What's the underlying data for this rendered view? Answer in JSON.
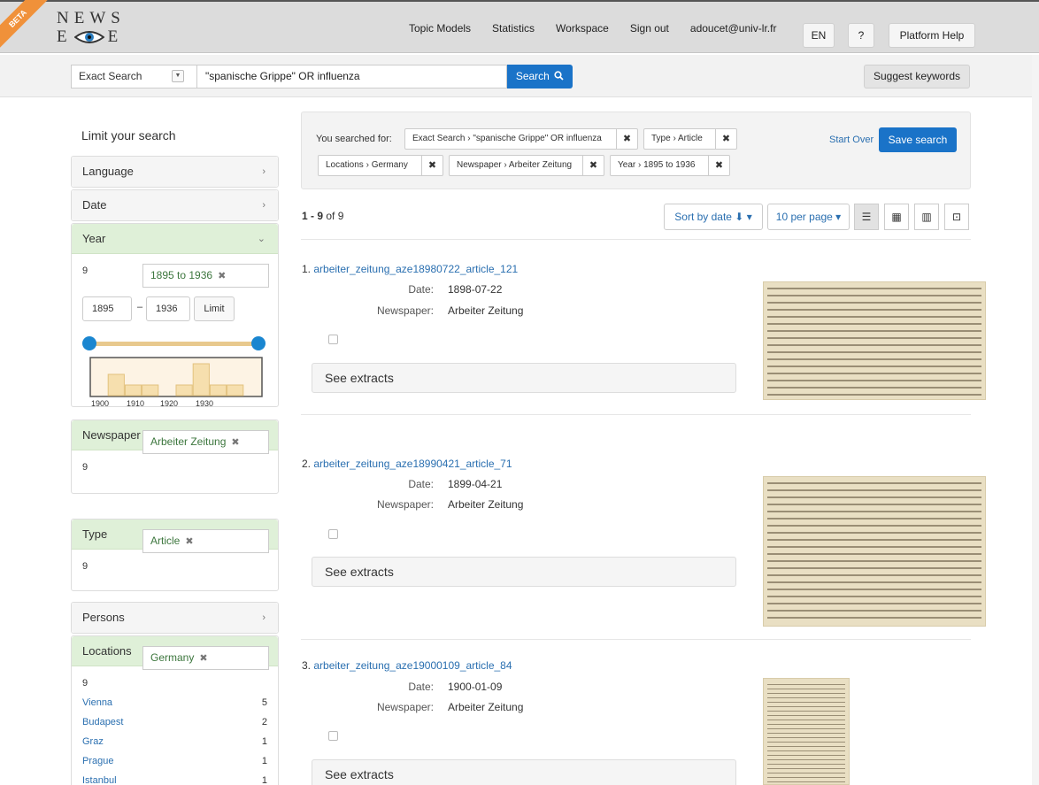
{
  "brand": {
    "beta": "BETA",
    "logo_top": "NEWS",
    "logo_left": "E",
    "logo_right": "E"
  },
  "nav": {
    "links": [
      "Topic Models",
      "Statistics",
      "Workspace",
      "Sign out",
      "adoucet@univ-lr.fr"
    ],
    "lang": "EN",
    "help_q": "?",
    "platform_help": "Platform Help"
  },
  "search": {
    "mode": "Exact Search",
    "query": "\"spanische Grippe\" OR influenza",
    "button": "Search",
    "suggest": "Suggest keywords"
  },
  "sidebar": {
    "title": "Limit your search",
    "language": "Language",
    "date": "Date",
    "year": {
      "label": "Year",
      "selected": "1895 to 1936",
      "count": "9",
      "from": "1895",
      "to": "1936",
      "dash": "–",
      "limit": "Limit",
      "histogram_ticks": [
        "1900",
        "1910",
        "1920",
        "1930"
      ],
      "histogram_values": [
        0,
        2,
        1,
        1,
        0,
        1,
        3,
        1,
        1,
        0
      ]
    },
    "newspaper": {
      "label": "Newspaper",
      "items": [
        {
          "name": "Arbeiter Zeitung",
          "count": "9"
        }
      ]
    },
    "type": {
      "label": "Type",
      "items": [
        {
          "name": "Article",
          "count": "9"
        }
      ]
    },
    "persons": "Persons",
    "locations": {
      "label": "Locations",
      "selected": {
        "name": "Germany",
        "count": "9"
      },
      "items": [
        {
          "name": "Vienna",
          "count": "5"
        },
        {
          "name": "Budapest",
          "count": "2"
        },
        {
          "name": "Graz",
          "count": "1"
        },
        {
          "name": "Prague",
          "count": "1"
        },
        {
          "name": "Istanbul",
          "count": "1"
        }
      ]
    }
  },
  "constraints": {
    "label": "You searched for:",
    "chips": [
      "Exact Search › \"spanische Grippe\" OR influenza",
      "Type › Article",
      "Locations › Germany",
      "Newspaper › Arbeiter Zeitung",
      "Year › 1895 to 1936"
    ],
    "start_over": "Start Over",
    "save": "Save search"
  },
  "results": {
    "range": "1 - 9",
    "of": "of 9",
    "sort": "Sort by date ⬇ ▾",
    "per_page": "10 per page ▾",
    "date_label": "Date:",
    "newspaper_label": "Newspaper:",
    "extracts": "See extracts",
    "docs": [
      {
        "num": "1.",
        "id": "arbeiter_zeitung_aze18980722_article_121",
        "date": "1898-07-22",
        "paper": "Arbeiter Zeitung"
      },
      {
        "num": "2.",
        "id": "arbeiter_zeitung_aze18990421_article_71",
        "date": "1899-04-21",
        "paper": "Arbeiter Zeitung"
      },
      {
        "num": "3.",
        "id": "arbeiter_zeitung_aze19000109_article_84",
        "date": "1900-01-09",
        "paper": "Arbeiter Zeitung"
      }
    ]
  },
  "icons": {
    "remove": "✖",
    "right": "›",
    "down": "⌄"
  },
  "colors": {
    "accent": "#1a73c8",
    "facet_open": "#dff0d8",
    "beta": "#f0913a",
    "link": "#2a6fb0"
  }
}
